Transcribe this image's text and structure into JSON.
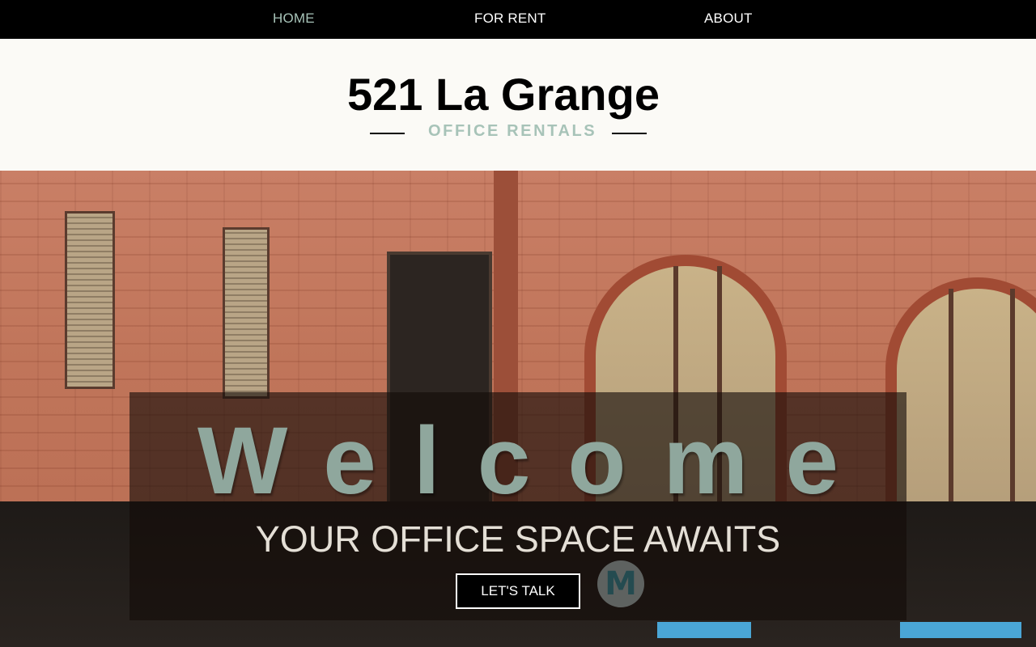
{
  "nav": {
    "items": [
      {
        "label": "HOME",
        "active": true
      },
      {
        "label": "FOR RENT",
        "active": false
      },
      {
        "label": "ABOUT",
        "active": false
      }
    ],
    "active_color": "#a7c3b8",
    "background": "#000000"
  },
  "header": {
    "title": "521 La Grange",
    "subtitle": "OFFICE RENTALS",
    "subtitle_color": "#a7c3b8"
  },
  "hero": {
    "heading": "Welcome",
    "tagline": "YOUR OFFICE SPACE AWAITS",
    "cta_label": "LET'S TALK",
    "heading_color": "#8fa79d",
    "background_image": "brick-office-building-photo",
    "sign_letter": "M"
  }
}
